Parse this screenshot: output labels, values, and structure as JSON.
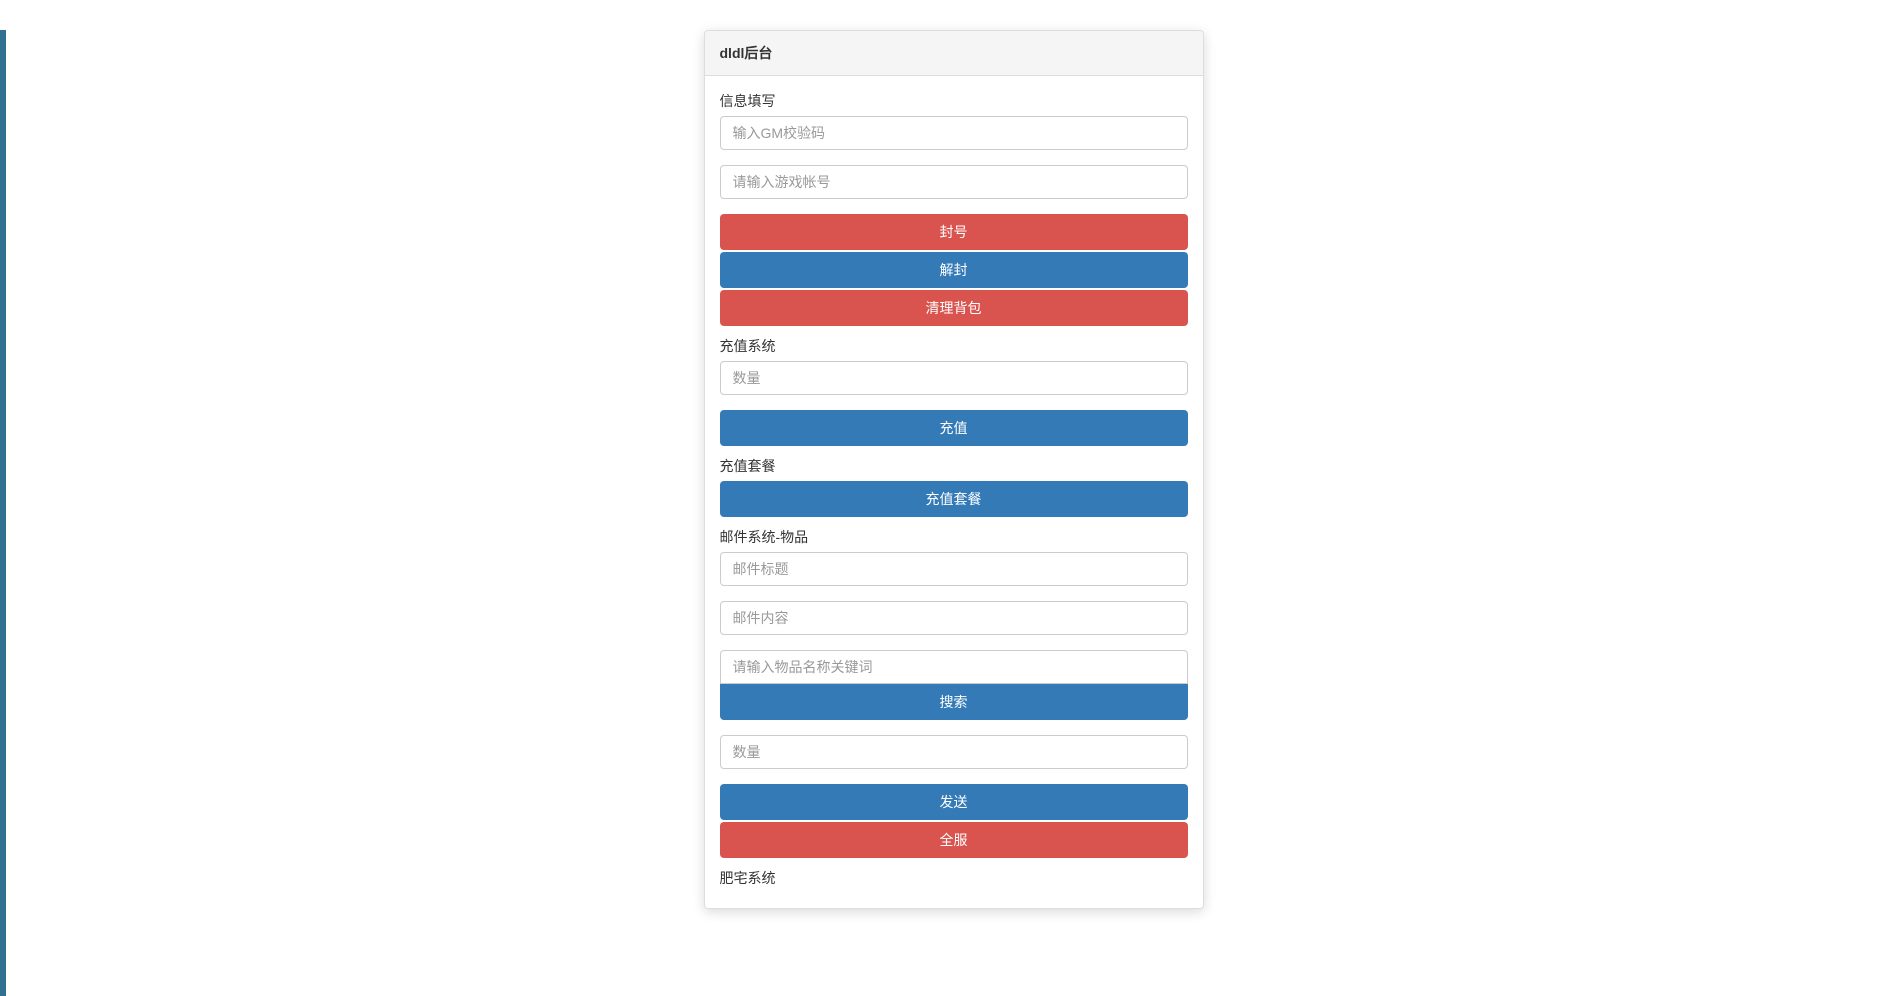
{
  "header": {
    "title": "dldl后台"
  },
  "sections": {
    "info": {
      "label": "信息填写",
      "gm_code_placeholder": "输入GM校验码",
      "account_placeholder": "请输入游戏帐号",
      "ban_button": "封号",
      "unban_button": "解封",
      "clear_bag_button": "清理背包"
    },
    "recharge": {
      "label": "充值系统",
      "quantity_placeholder": "数量",
      "recharge_button": "充值"
    },
    "recharge_package": {
      "label": "充值套餐",
      "package_button": "充值套餐"
    },
    "mail_item": {
      "label": "邮件系统-物品",
      "title_placeholder": "邮件标题",
      "content_placeholder": "邮件内容",
      "search_placeholder": "请输入物品名称关键词",
      "search_button": "搜索",
      "quantity_placeholder": "数量",
      "send_button": "发送",
      "all_server_button": "全服"
    },
    "feizhai": {
      "label": "肥宅系统"
    }
  }
}
